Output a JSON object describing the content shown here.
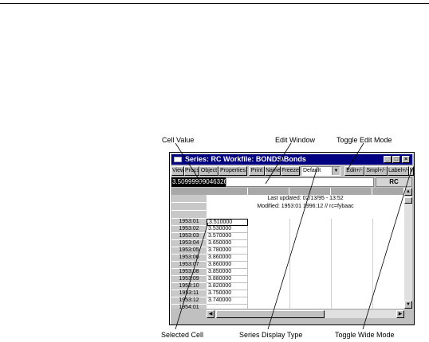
{
  "callouts": {
    "cell_value": "Cell Value",
    "edit_window": "Edit Window",
    "toggle_edit_mode": "Toggle Edit Mode",
    "selected_cell": "Selected Cell",
    "series_display_type": "Series Display Type",
    "toggle_wide_mode": "Toggle Wide Mode"
  },
  "window": {
    "title": "Series: RC   Workfile: BONDS\\Bonds",
    "minimize": "_",
    "maximize": "□",
    "close": "×"
  },
  "toolbar": {
    "view": "View",
    "procs": "Procs",
    "object": "Object",
    "properties": "Properties",
    "print": "Print",
    "name": "Name",
    "freeze": "Freeze",
    "display_type": "Default",
    "edit": "Edit+/-",
    "smpl": "Smpl+/-",
    "label": "Label+/-",
    "wide": "W"
  },
  "edit_bar": {
    "value": "3.50999999046326",
    "series_name": "RC"
  },
  "header": {
    "last_updated": "Last updated: 02/13/95 - 13:52",
    "modified": "Modified: 1953:01 1996:12 // rc=fybaac"
  },
  "rows": [
    {
      "date": "1953:01",
      "value": "3.510000"
    },
    {
      "date": "1953:02",
      "value": "3.530000"
    },
    {
      "date": "1953:03",
      "value": "3.570000"
    },
    {
      "date": "1953:04",
      "value": "3.650000"
    },
    {
      "date": "1953:05",
      "value": "3.780000"
    },
    {
      "date": "1953:06",
      "value": "3.860000"
    },
    {
      "date": "1953:07",
      "value": "3.860000"
    },
    {
      "date": "1953:08",
      "value": "3.850000"
    },
    {
      "date": "1953:09",
      "value": "3.880000"
    },
    {
      "date": "1953:10",
      "value": "3.820000"
    },
    {
      "date": "1953:11",
      "value": "3.750000"
    },
    {
      "date": "1953:12",
      "value": "3.740000"
    },
    {
      "date": "1954:01",
      "value": ""
    }
  ],
  "scroll_icons": {
    "up": "▲",
    "down": "▼",
    "left": "◀",
    "right": "▶"
  }
}
